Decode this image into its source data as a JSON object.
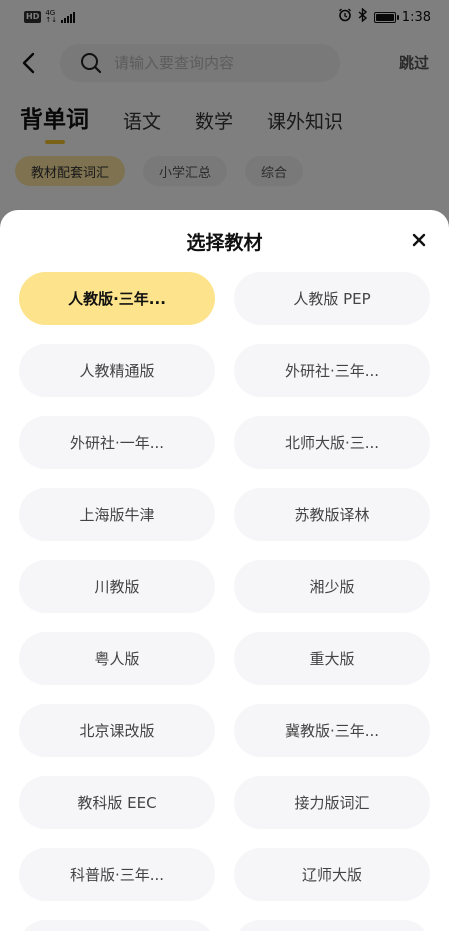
{
  "status_bar": {
    "hd": "HD",
    "network": "4G",
    "network_sub": "↑↓",
    "time": "1:38"
  },
  "header": {
    "search_placeholder": "请输入要查询内容",
    "skip_label": "跳过"
  },
  "category_tabs": [
    "背单词",
    "语文",
    "数学",
    "课外知识"
  ],
  "sub_tabs": [
    "教材配套词汇",
    "小学汇总",
    "综合"
  ],
  "sheet": {
    "title": "选择教材",
    "items": [
      "人教版·三年...",
      "人教版 PEP",
      "人教精通版",
      "外研社·三年...",
      "外研社·一年...",
      "北师大版·三...",
      "上海版牛津",
      "苏教版译林",
      "川教版",
      "湘少版",
      "粤人版",
      "重大版",
      "北京课改版",
      "冀教版·三年...",
      "教科版 EEC",
      "接力版词汇",
      "科普版·三年...",
      "辽师大版",
      "",
      ""
    ],
    "selected_index": 0
  },
  "colors": {
    "accent": "#f5c42c",
    "selected_bg": "#fde38b",
    "item_bg": "#f6f5f7"
  },
  "icons": {
    "back": "chevron-left-icon",
    "search": "search-icon",
    "close": "close-icon",
    "alarm": "alarm-icon",
    "bluetooth": "bluetooth-icon",
    "battery": "battery-icon"
  }
}
